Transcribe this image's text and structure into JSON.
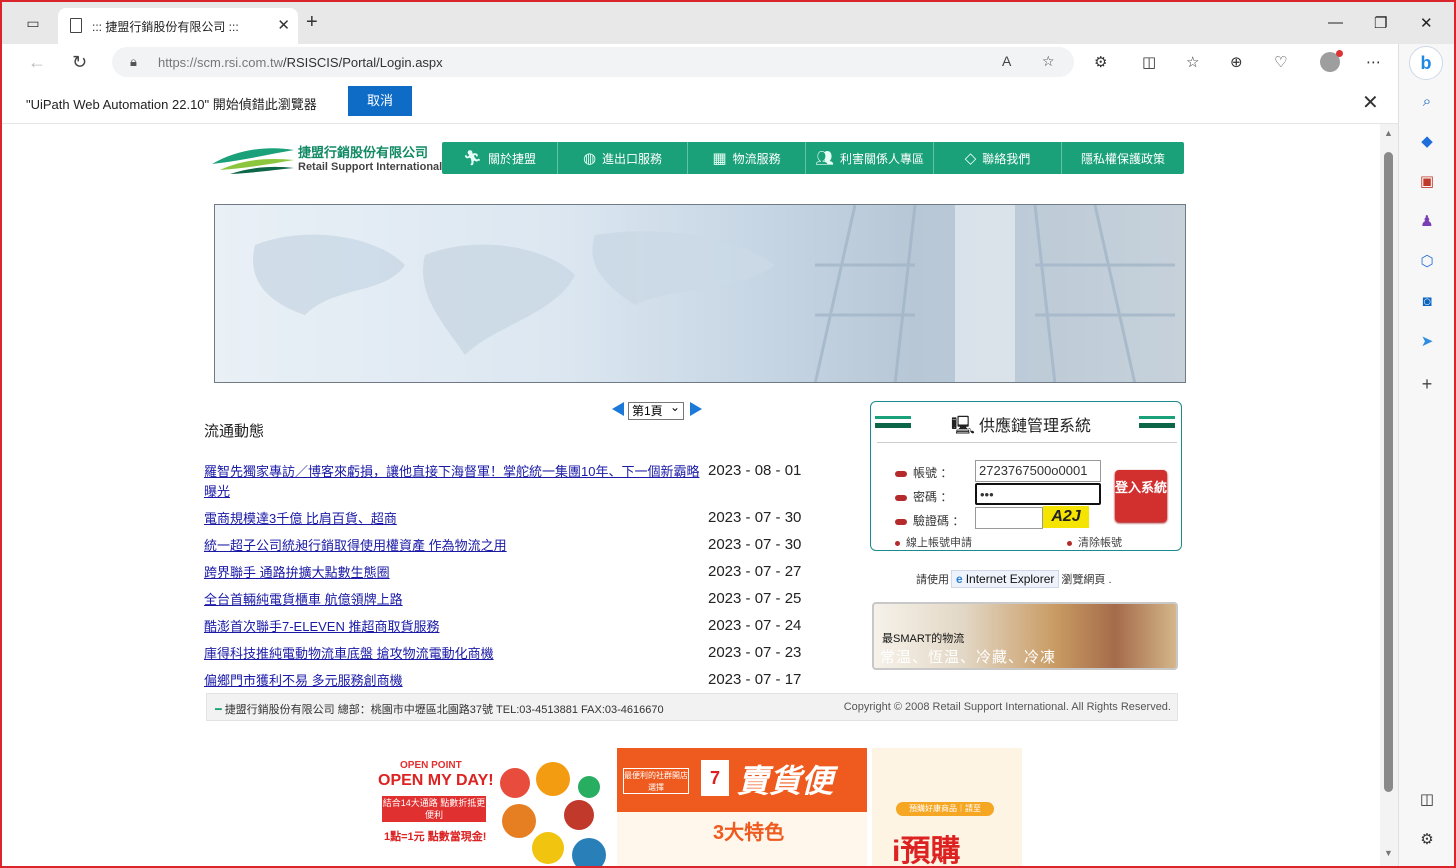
{
  "browser": {
    "tab_title": "::: 捷盟行銷股份有限公司 :::",
    "url_domain": "https://scm.rsi.com.tw",
    "url_path": "/RSISCIS/Portal/Login.aspx",
    "infobar_message": "\"UiPath Web Automation 22.10\" 開始偵錯此瀏覽器",
    "infobar_cancel": "取消"
  },
  "site": {
    "logo_cn": "捷盟行銷股份有限公司",
    "logo_en": "Retail  Support  International",
    "nav": [
      {
        "label": "關於捷盟",
        "icon": "runner-icon"
      },
      {
        "label": "進出口服務",
        "icon": "globe-icon"
      },
      {
        "label": "物流服務",
        "icon": "boxes-icon"
      },
      {
        "label": "利害關係人專區",
        "icon": "people-icon"
      },
      {
        "label": "聯絡我們",
        "icon": "diamond-icon"
      },
      {
        "label": "隱私權保護政策",
        "icon": ""
      }
    ]
  },
  "pager": {
    "selected": "第1頁"
  },
  "news": {
    "title": "流通動態",
    "items": [
      {
        "text": "羅智先獨家專訪／博客來虧損，讓他直接下海督軍！掌舵統一集團10年、下一個新霸略曝光",
        "date": "2023 - 08 - 01"
      },
      {
        "text": "電商規模達3千億 比肩百貨、超商",
        "date": "2023 - 07 - 30"
      },
      {
        "text": "統一超子公司統昶行銷取得使用權資產 作為物流之用",
        "date": "2023 - 07 - 30"
      },
      {
        "text": "跨界聯手 通路拚擴大點數生態圈",
        "date": "2023 - 07 - 27"
      },
      {
        "text": "全台首輛純電貨櫃車 航億領牌上路",
        "date": "2023 - 07 - 25"
      },
      {
        "text": "酷澎首次聯手7-ELEVEN 推超商取貨服務",
        "date": "2023 - 07 - 24"
      },
      {
        "text": "庫得科技推純電動物流車底盤 搶攻物流電動化商機",
        "date": "2023 - 07 - 23"
      },
      {
        "text": "偏鄉門市獲利不易 多元服務創商機",
        "date": "2023 - 07 - 17"
      }
    ]
  },
  "login": {
    "title": "供應鏈管理系統",
    "account_label": "帳號 ：",
    "account_value": "2723767500o0001",
    "password_label": "密碼 ：",
    "password_value": "•••",
    "captcha_label": "驗證碼 ：",
    "captcha_value": "",
    "captcha_text": "A2J",
    "submit_label": "登入系統",
    "apply_link": "線上帳號申請",
    "clear_link": "清除帳號"
  },
  "ie_note": {
    "prefix": "請使用",
    "browser": "Internet Explorer",
    "suffix": "瀏覽網頁 ."
  },
  "smart": {
    "line1": "最SMART的物流",
    "line2": "常温、恆温、冷藏、冷凍"
  },
  "footer": {
    "left": "捷盟行銷股份有限公司 總部：桃園市中壢區北園路37號 TEL:03-4513881 FAX:03-4616670",
    "right": "Copyright © 2008 Retail Support International. All Rights Reserved."
  },
  "ads": {
    "openpoint": "OPEN POINT",
    "openmyday": "OPEN MY DAY!",
    "promo1": "結合14大通路 點數折抵更便利",
    "points": "1點=1元 點數當現金!",
    "social": "最便利的社群開店選擇",
    "seven": "7",
    "maihuobian": "賣貨便",
    "three": "3大特色",
    "preorder_badge": "預購好康商品｜請至",
    "ipreorder": "i預購"
  },
  "colors": {
    "nav_green": "#1aa179",
    "accent_red": "#d22f2f",
    "link_blue": "#1a1aa6"
  }
}
